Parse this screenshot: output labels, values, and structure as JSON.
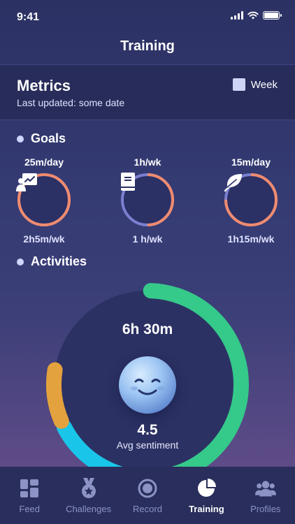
{
  "status_bar": {
    "time": "9:41"
  },
  "header": {
    "title": "Training"
  },
  "metrics": {
    "title": "Metrics",
    "last_updated": "Last updated: some date",
    "period_label": "Week"
  },
  "goals": {
    "heading": "Goals",
    "items": [
      {
        "target": "25m/day",
        "actual": "2h5m/wk",
        "icon": "presentation-icon",
        "progress": 1.0
      },
      {
        "target": "1h/wk",
        "actual": "1 h/wk",
        "icon": "book-icon",
        "progress": 0.5
      },
      {
        "target": "15m/day",
        "actual": "1h15m/wk",
        "icon": "leaf-icon",
        "progress": 0.75
      }
    ]
  },
  "activities": {
    "heading": "Activities",
    "duration": "6h 30m",
    "sentiment_value": "4.5",
    "sentiment_label": "Avg sentiment",
    "icon": "smiling-face-icon",
    "segments": [
      {
        "color": "#35c98a",
        "fraction": 0.5
      },
      {
        "color": "#19c6ea",
        "fraction": 0.18
      },
      {
        "color": "#e3a23d",
        "fraction": 0.1
      }
    ]
  },
  "colors": {
    "ring_progress": "#f08b6e",
    "ring_track": "#7b7fd0",
    "background": "#2b3163"
  },
  "tabs": [
    {
      "label": "Feed",
      "icon": "grid-icon",
      "active": false
    },
    {
      "label": "Challenges",
      "icon": "medal-icon",
      "active": false
    },
    {
      "label": "Record",
      "icon": "record-icon",
      "active": false
    },
    {
      "label": "Training",
      "icon": "pie-chart-icon",
      "active": true
    },
    {
      "label": "Profiles",
      "icon": "people-icon",
      "active": false
    }
  ]
}
